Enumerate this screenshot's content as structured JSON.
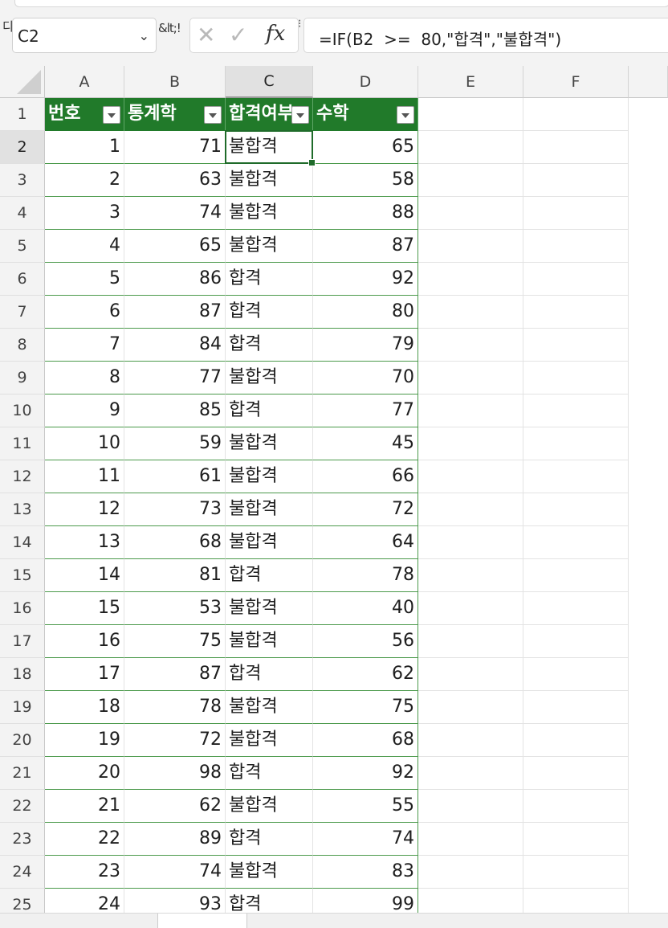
{
  "toolbar": {
    "clip_glyph": "디",
    "name_box": "C2",
    "name_box_arrow": "⌄",
    "truncated_glyph": "&lt;!",
    "divider_glyph": "⁝",
    "formula": "=IF(B2  >=  80,\"합격\",\"불합격\")"
  },
  "columns": [
    "A",
    "B",
    "C",
    "D",
    "E",
    "F"
  ],
  "table": {
    "headers": [
      "번호",
      "통계학",
      "합격여부",
      "수학"
    ],
    "rows": [
      [
        "1",
        "71",
        "불합격",
        "65"
      ],
      [
        "2",
        "63",
        "불합격",
        "58"
      ],
      [
        "3",
        "74",
        "불합격",
        "88"
      ],
      [
        "4",
        "65",
        "불합격",
        "87"
      ],
      [
        "5",
        "86",
        "합격",
        "92"
      ],
      [
        "6",
        "87",
        "합격",
        "80"
      ],
      [
        "7",
        "84",
        "합격",
        "79"
      ],
      [
        "8",
        "77",
        "불합격",
        "70"
      ],
      [
        "9",
        "85",
        "합격",
        "77"
      ],
      [
        "10",
        "59",
        "불합격",
        "45"
      ],
      [
        "11",
        "61",
        "불합격",
        "66"
      ],
      [
        "12",
        "73",
        "불합격",
        "72"
      ],
      [
        "13",
        "68",
        "불합격",
        "64"
      ],
      [
        "14",
        "81",
        "합격",
        "78"
      ],
      [
        "15",
        "53",
        "불합격",
        "40"
      ],
      [
        "16",
        "75",
        "불합격",
        "56"
      ],
      [
        "17",
        "87",
        "합격",
        "62"
      ],
      [
        "18",
        "78",
        "불합격",
        "75"
      ],
      [
        "19",
        "72",
        "불합격",
        "68"
      ],
      [
        "20",
        "98",
        "합격",
        "92"
      ],
      [
        "21",
        "62",
        "불합격",
        "55"
      ],
      [
        "22",
        "89",
        "합격",
        "74"
      ],
      [
        "23",
        "74",
        "불합격",
        "83"
      ],
      [
        "24",
        "93",
        "합격",
        "99"
      ]
    ]
  },
  "selection": {
    "column": "C",
    "row": 2
  },
  "colors": {
    "header_bg": "#217a2a",
    "header_text": "#ffffff",
    "selection": "#1f6b2a"
  }
}
